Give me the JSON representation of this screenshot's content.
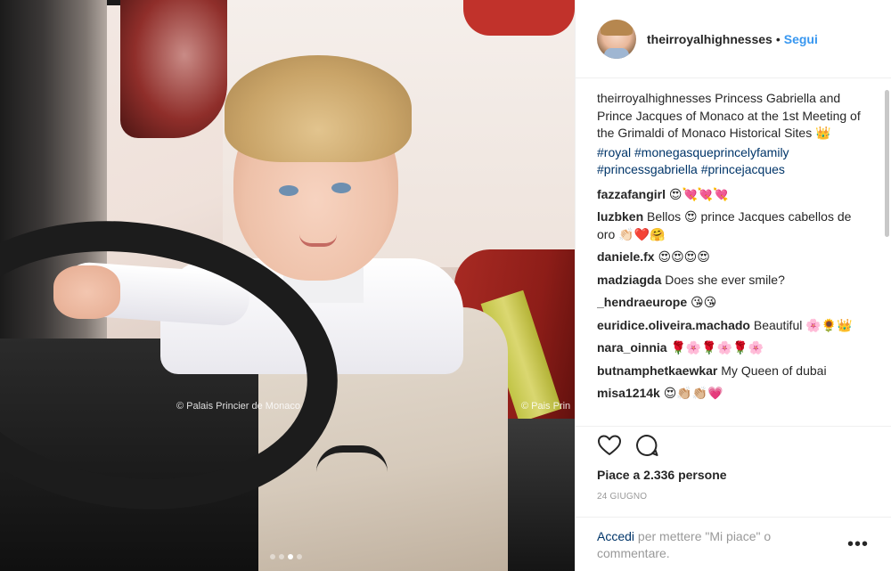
{
  "photo": {
    "watermark": "© Palais Princier de Monaco",
    "watermark_right": "© Pais Prin",
    "carousel_dots": 4,
    "carousel_active": 3
  },
  "header": {
    "username": "theirroyalhighnesses",
    "separator": "•",
    "follow_label": "Segui"
  },
  "caption": {
    "username": "theirroyalhighnesses",
    "text": "Princess Gabriella and Prince Jacques of Monaco at the 1st Meeting of the Grimaldi of Monaco Historical Sites 👑",
    "hashtags": "#royal #monegasqueprincelyfamily #princessgabriella #princejacques"
  },
  "comments": [
    {
      "user": "fazzafangirl",
      "text": "😍💘💘💘"
    },
    {
      "user": "luzbken",
      "text": "Bellos 😍 prince Jacques cabellos de oro 👏🏻❤️🤗"
    },
    {
      "user": "daniele.fx",
      "text": "😍😍😍😍"
    },
    {
      "user": "madziagda",
      "text": "Does she ever smile?"
    },
    {
      "user": "_hendraeurope",
      "text": "😘😘"
    },
    {
      "user": "euridice.oliveira.machado",
      "text": "Beautiful 🌸🌻👑"
    },
    {
      "user": "nara_oinnia",
      "text": "🌹🌸🌹🌸🌹🌸"
    },
    {
      "user": "butnamphetkaewkar",
      "text": "My Queen of dubai"
    },
    {
      "user": "misa1214k",
      "text": "😍👏🏼👏🏼💗"
    }
  ],
  "actions": {
    "like_icon": "heart-icon",
    "comment_icon": "comment-bubble-icon"
  },
  "likes_text": "Piace a 2.336 persone",
  "date_text": "24 GIUGNO",
  "login": {
    "link": "Accedi",
    "rest": "per mettere \"Mi piace\" o commentare."
  },
  "more_label": "•••",
  "colors": {
    "link_blue": "#3897f0",
    "hashtag": "#003569",
    "text": "#262626",
    "muted": "#999999"
  }
}
